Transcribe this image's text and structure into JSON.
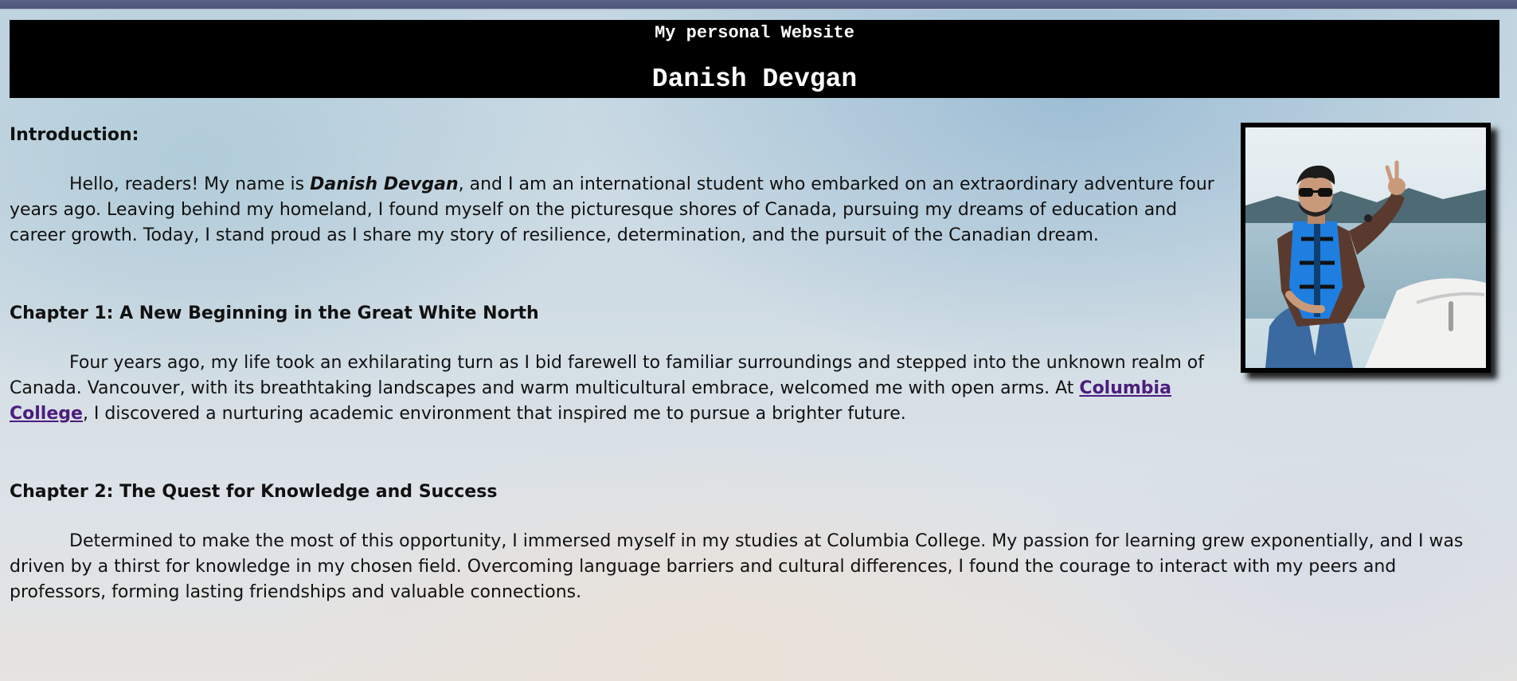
{
  "header": {
    "site_title": "My personal Website",
    "owner_name": "Danish Devgan"
  },
  "intro": {
    "heading": "Introduction:",
    "text_before_name": "Hello, readers! My name is ",
    "name": "Danish Devgan",
    "text_after_name": ", and I am an international student who embarked on an extraordinary adventure four years ago. Leaving behind my homeland, I found myself on the picturesque shores of Canada, pursuing my dreams of education and career growth. Today, I stand proud as I share my story of resilience, determination, and the pursuit of the Canadian dream."
  },
  "chapter1": {
    "heading": "Chapter 1: A New Beginning in the Great White North",
    "text_before_link": "Four years ago, my life took an exhilarating turn as I bid farewell to familiar surroundings and stepped into the unknown realm of Canada. Vancouver, with its breathtaking landscapes and warm multicultural embrace, welcomed me with open arms. At ",
    "link_text": "Columbia College",
    "text_after_link": ", I discovered a nurturing academic environment that inspired me to pursue a brighter future."
  },
  "chapter2": {
    "heading": "Chapter 2: The Quest for Knowledge and Success",
    "text": "Determined to make the most of this opportunity, I immersed myself in my studies at Columbia College. My passion for learning grew exponentially, and I was driven by a thirst for knowledge in my chosen field. Overcoming language barriers and cultural differences, I found the courage to interact with my peers and professors, forming lasting friendships and valuable connections."
  }
}
